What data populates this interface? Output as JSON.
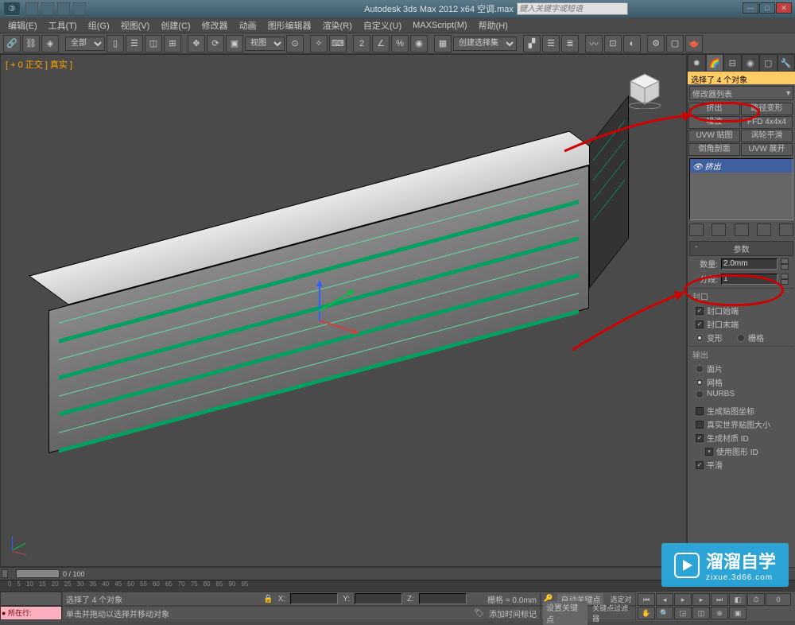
{
  "title": "Autodesk 3ds Max  2012 x64   空调.max",
  "search_placeholder": "键入关键字或短语",
  "menu": [
    "编辑(E)",
    "工具(T)",
    "组(G)",
    "视图(V)",
    "创建(C)",
    "修改器",
    "动画",
    "图形编辑器",
    "渲染(R)",
    "自定义(U)",
    "MAXScript(M)",
    "帮助(H)"
  ],
  "tb_all": "全部",
  "tb_view": "视图",
  "tb_createset": "创建选择集",
  "vp_label": "[ + 0 正交 ] 真实 ]",
  "cmd": {
    "selection": "选择了 4 个对象",
    "modlist": "修改器列表",
    "btns": [
      "挤出",
      "路径变形",
      "噪波",
      "FFD 4x4x4",
      "UVW 贴图",
      "涡轮平滑",
      "倒角剖面",
      "UVW 展开"
    ],
    "stack_item": "挤出",
    "param_hdr": "参数",
    "amount_lbl": "数量:",
    "amount_val": "2.0mm",
    "seg_lbl": "分段:",
    "seg_val": "1",
    "cap_hdr": "封口",
    "cap_start": "封口始端",
    "cap_end": "封口末端",
    "morph": "变形",
    "grid": "栅格",
    "out_hdr": "输出",
    "out_patch": "面片",
    "out_mesh": "网格",
    "out_nurbs": "NURBS",
    "gen_map": "生成贴图坐标",
    "real_world": "真实世界贴图大小",
    "gen_mat": "生成材质 ID",
    "use_shape": "使用图形 ID",
    "smooth": "平滑"
  },
  "time": {
    "range": "0 / 100"
  },
  "status": {
    "line1": "选择了 4 个对象",
    "line2": "单击并拖动以选择并移动对象",
    "loc": "所在行:",
    "grid": "栅格 = 0.0mm",
    "autokey": "自动关键点",
    "selkey": "选定对",
    "setkey": "设置关键点",
    "keyfilter": "关键点过滤器",
    "addtime": "添加时间标记"
  },
  "watermark": {
    "big": "溜溜自学",
    "small": "zixue.3d66.com"
  }
}
